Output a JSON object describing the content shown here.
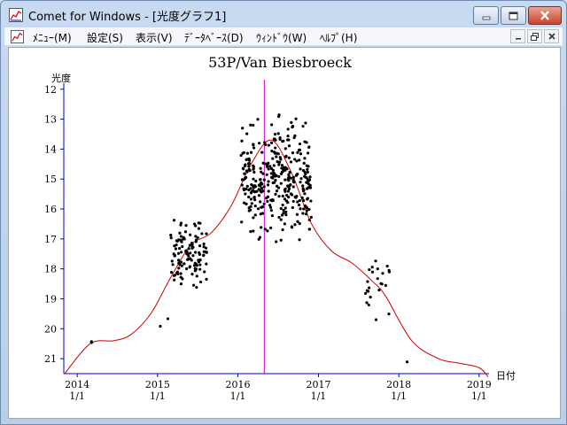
{
  "window": {
    "title": "Comet for Windows - [光度グラフ1]",
    "icons": [
      "graph-app-icon",
      "minimize-icon",
      "maximize-icon",
      "close-icon"
    ]
  },
  "menubar": {
    "items": [
      "ﾒﾆｭｰ(M)",
      "設定(S)",
      "表示(V)",
      "ﾃﾞｰﾀﾍﾞｰｽ(D)",
      "ｳｨﾝﾄﾞｳ(W)",
      "ﾍﾙﾌﾟ(H)"
    ],
    "mdi_icons": [
      "child-minimize-icon",
      "child-restore-icon",
      "child-close-icon"
    ]
  },
  "chart_data": {
    "type": "scatter",
    "title": "53P/Van Biesbroeck",
    "ylabel": "光度",
    "xlabel": "日付",
    "ylim": [
      21.5,
      11.8
    ],
    "y_inverted": true,
    "xlim": [
      "2013-11-01",
      "2019-02-15"
    ],
    "y_ticks": [
      12,
      13,
      14,
      15,
      16,
      17,
      18,
      19,
      20,
      21
    ],
    "x_ticks": [
      {
        "date": "2014-01-01",
        "year": "2014",
        "md": "1/1"
      },
      {
        "date": "2015-01-01",
        "year": "2015",
        "md": "1/1"
      },
      {
        "date": "2016-01-01",
        "year": "2016",
        "md": "1/1"
      },
      {
        "date": "2017-01-01",
        "year": "2017",
        "md": "1/1"
      },
      {
        "date": "2018-01-01",
        "year": "2018",
        "md": "1/1"
      },
      {
        "date": "2019-01-01",
        "year": "2019",
        "md": "1/1"
      }
    ],
    "perihelion_date": "2016-04-30",
    "colors": {
      "axis": "#0000c0",
      "points": "#000000",
      "curve": "#cc0000",
      "marker": "#cc00cc"
    },
    "predicted_curve": [
      [
        "2013-11-05",
        21.5
      ],
      [
        "2014-03-01",
        20.5
      ],
      [
        "2014-06-15",
        20.4
      ],
      [
        "2014-09-01",
        20.2
      ],
      [
        "2014-12-01",
        19.5
      ],
      [
        "2015-03-01",
        18.3
      ],
      [
        "2015-06-01",
        17.2
      ],
      [
        "2015-09-01",
        16.8
      ],
      [
        "2015-12-01",
        15.9
      ],
      [
        "2016-03-01",
        14.5
      ],
      [
        "2016-06-01",
        13.7
      ],
      [
        "2016-09-01",
        14.8
      ],
      [
        "2016-12-01",
        16.5
      ],
      [
        "2017-03-01",
        17.4
      ],
      [
        "2017-06-01",
        17.8
      ],
      [
        "2017-09-01",
        18.4
      ],
      [
        "2017-11-01",
        18.9
      ],
      [
        "2018-03-01",
        20.4
      ],
      [
        "2018-07-01",
        21.0
      ],
      [
        "2018-10-01",
        21.15
      ],
      [
        "2019-01-01",
        21.3
      ],
      [
        "2019-02-10",
        21.6
      ]
    ],
    "observation_clusters": [
      {
        "from": "2014-03-01",
        "to": "2014-03-10",
        "mag_min": 20.2,
        "mag_max": 20.6,
        "count": 3
      },
      {
        "from": "2015-01-01",
        "to": "2015-03-01",
        "mag_min": 19.5,
        "mag_max": 20.0,
        "count": 2
      },
      {
        "from": "2015-03-01",
        "to": "2015-08-15",
        "mag_min": 16.0,
        "mag_max": 19.0,
        "count": 120
      },
      {
        "from": "2016-01-15",
        "to": "2016-12-01",
        "mag_min": 12.5,
        "mag_max": 17.6,
        "count": 340
      },
      {
        "from": "2017-08-01",
        "to": "2017-11-20",
        "mag_min": 17.0,
        "mag_max": 20.2,
        "count": 24
      },
      {
        "from": "2018-01-20",
        "to": "2018-02-10",
        "mag_min": 21.0,
        "mag_max": 21.2,
        "count": 1
      }
    ]
  }
}
